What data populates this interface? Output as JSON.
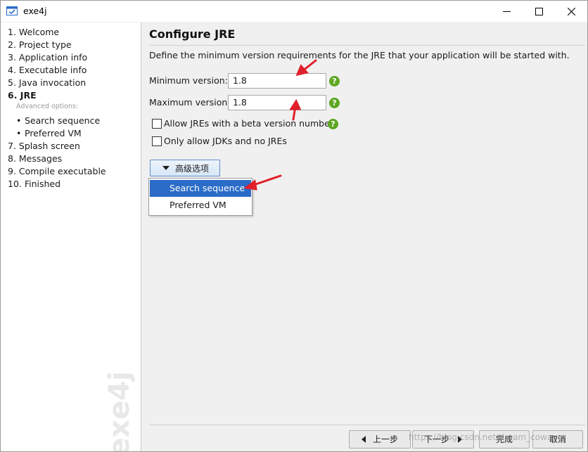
{
  "window": {
    "title": "exe4j"
  },
  "sidebar": {
    "steps": [
      "1. Welcome",
      "2. Project type",
      "3. Application info",
      "4. Executable info",
      "5. Java invocation",
      "6. JRE",
      "7. Splash screen",
      "8. Messages",
      "9. Compile executable",
      "10. Finished"
    ],
    "active_step": "6. JRE",
    "advanced_label": "Advanced options:",
    "advanced_items": [
      "Search sequence",
      "Preferred VM"
    ],
    "watermark": "exe4j"
  },
  "main": {
    "title": "Configure JRE",
    "description": "Define the minimum version requirements for the JRE that your application will be started with.",
    "min_version": {
      "label": "Minimum version:",
      "value": "1.8"
    },
    "max_version": {
      "label": "Maximum version:",
      "value": "1.8"
    },
    "checkboxes": [
      {
        "label": "Allow JREs with a beta version number",
        "checked": false
      },
      {
        "label": "Only allow JDKs and no JREs",
        "checked": false
      }
    ],
    "advanced_button": "高级选项",
    "dropdown": {
      "items": [
        "Search sequence",
        "Preferred VM"
      ],
      "selected": "Search sequence"
    },
    "help_icon": "?"
  },
  "footer": {
    "back": "上一步",
    "next": "下一步",
    "finish": "完成",
    "cancel": "取消"
  },
  "overlay_text": "https://blog.csdn.net/dream_cowave",
  "colors": {
    "accent": "#2a6cc8",
    "help": "#5da722",
    "annotation_arrow": "#e0202a"
  }
}
